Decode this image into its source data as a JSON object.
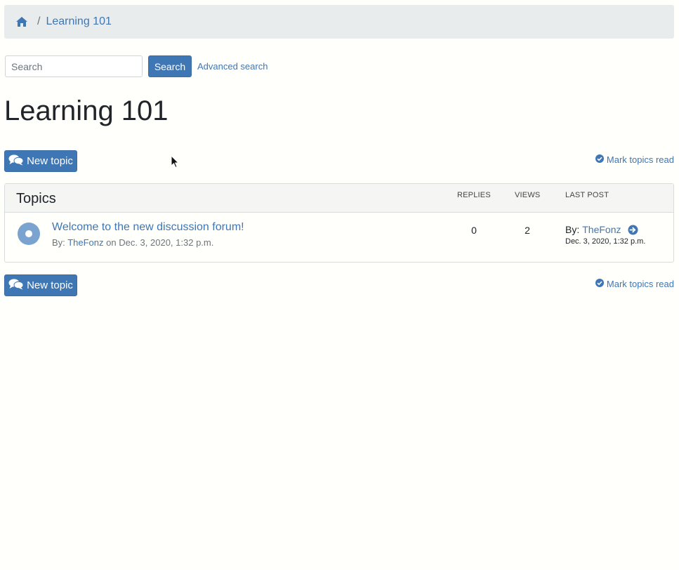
{
  "breadcrumb": {
    "home_icon": "home-icon",
    "separator": "/",
    "current": "Learning 101"
  },
  "search": {
    "placeholder": "Search",
    "value": "",
    "button_label": "Search",
    "advanced_label": "Advanced search"
  },
  "page": {
    "title": "Learning 101"
  },
  "actions": {
    "new_topic_label": "New topic",
    "new_topic_icon": "comments-icon",
    "mark_read_label": "Mark topics read",
    "mark_read_icon": "check-circle-icon"
  },
  "topics": {
    "heading": "Topics",
    "columns": {
      "replies": "REPLIES",
      "views": "VIEWS",
      "last_post": "LAST POST"
    },
    "rows": [
      {
        "title": "Welcome to the new discussion forum!",
        "by_label": "By:",
        "author": "TheFonz",
        "on_label": "on",
        "date": "Dec. 3, 2020, 1:32 p.m.",
        "replies": "0",
        "views": "2",
        "last_post_by_label": "By:",
        "last_post_author": "TheFonz",
        "last_post_date": "Dec. 3, 2020, 1:32 p.m."
      }
    ]
  },
  "colors": {
    "accent": "#3f76b4",
    "breadcrumb_bg": "#e9ecec",
    "topic_dot": "#7ba3d0"
  }
}
